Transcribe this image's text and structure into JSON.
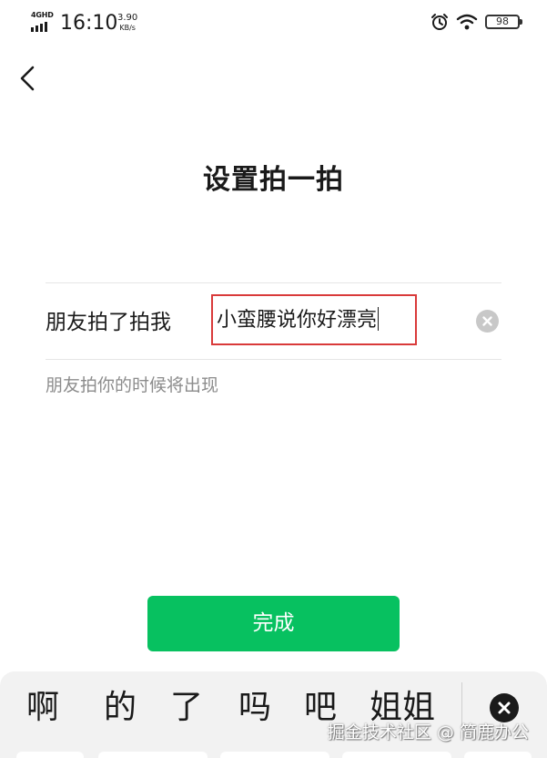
{
  "status_bar": {
    "network": "4GHD",
    "time": "16:10",
    "speed_value": "3.90",
    "speed_unit": "KB/s",
    "battery": "98",
    "icons": [
      "alarm-icon",
      "wifi-icon",
      "battery-icon"
    ]
  },
  "nav": {
    "back_icon": "chevron-left-icon"
  },
  "page": {
    "title": "设置拍一拍"
  },
  "form": {
    "label": "朋友拍了拍我",
    "value": "小蛮腰说你好漂亮",
    "hint": "朋友拍你的时候将出现",
    "clear_icon": "clear-circle-icon"
  },
  "actions": {
    "done_label": "完成",
    "accent": "#07c160",
    "highlight": "#d93a3a"
  },
  "keyboard": {
    "candidates": [
      "啊",
      "的",
      "了",
      "吗",
      "吧",
      "姐姐"
    ],
    "close_icon": "close-circle-icon"
  },
  "watermark": "掘金技术社区 @ 简鹿办公"
}
